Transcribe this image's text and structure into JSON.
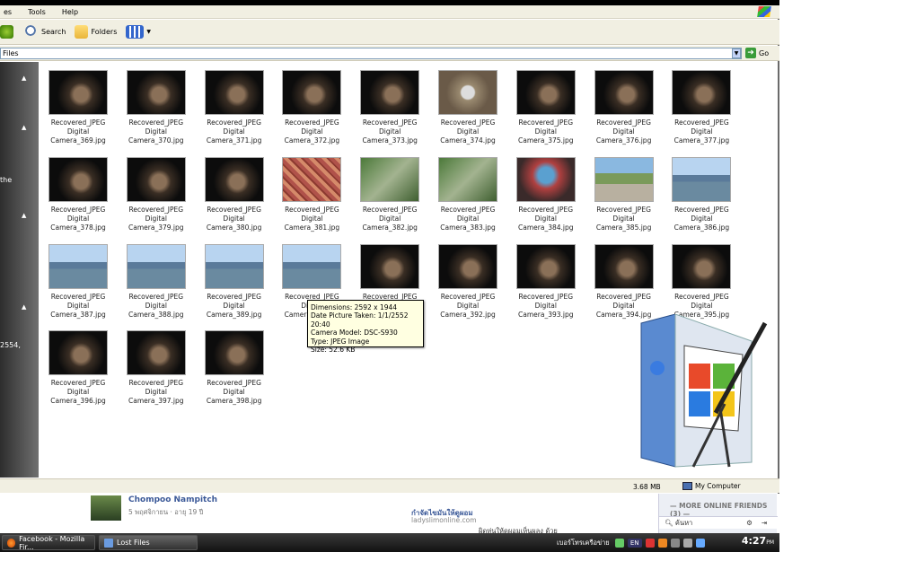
{
  "menu": {
    "items": [
      "es",
      "Tools",
      "Help"
    ]
  },
  "toolbar": {
    "search": "Search",
    "folders": "Folders"
  },
  "address": {
    "value": "Files",
    "go": "Go"
  },
  "left": {
    "text1": "the",
    "text2": "2554,"
  },
  "files": [
    "Recovered_JPEG Digital Camera_369.jpg",
    "Recovered_JPEG Digital Camera_370.jpg",
    "Recovered_JPEG Digital Camera_371.jpg",
    "Recovered_JPEG Digital Camera_372.jpg",
    "Recovered_JPEG Digital Camera_373.jpg",
    "Recovered_JPEG Digital Camera_374.jpg",
    "Recovered_JPEG Digital Camera_375.jpg",
    "Recovered_JPEG Digital Camera_376.jpg",
    "Recovered_JPEG Digital Camera_377.jpg",
    "Recovered_JPEG Digital Camera_378.jpg",
    "Recovered_JPEG Digital Camera_379.jpg",
    "Recovered_JPEG Digital Camera_380.jpg",
    "Recovered_JPEG Digital Camera_381.jpg",
    "Recovered_JPEG Digital Camera_382.jpg",
    "Recovered_JPEG Digital Camera_383.jpg",
    "Recovered_JPEG Digital Camera_384.jpg",
    "Recovered_JPEG Digital Camera_385.jpg",
    "Recovered_JPEG Digital Camera_386.jpg",
    "Recovered_JPEG Digital Camera_387.jpg",
    "Recovered_JPEG Digital Camera_388.jpg",
    "Recovered_JPEG Digital Camera_389.jpg",
    "Recovered_JPEG Digital Camera_390.jpg",
    "Recovered_JPEG Digital Camera_391.jpg",
    "Recovered_JPEG Digital Camera_392.jpg",
    "Recovered_JPEG Digital Camera_393.jpg",
    "Recovered_JPEG Digital Camera_394.jpg",
    "Recovered_JPEG Digital Camera_395.jpg",
    "Recovered_JPEG Digital Camera_396.jpg",
    "Recovered_JPEG Digital Camera_397.jpg",
    "Recovered_JPEG Digital Camera_398.jpg"
  ],
  "tooltip": {
    "dimensions": "Dimensions: 2592 x 1944",
    "date": "Date Picture Taken: 1/1/2552 20:40",
    "camera": "Camera Model: DSC-S930",
    "type": "Type: JPEG Image",
    "size": "Size: 52.6 KB"
  },
  "status": {
    "size": "3.68 MB",
    "location": "My Computer"
  },
  "facebook": {
    "name": "Chompoo Nampitch",
    "date": "5 พฤศจิกายน · อายุ 19 ปี",
    "ad_title": "กำจัดไขมันให้ดูผอม",
    "ad_url": "ladyslimonline.com",
    "ad_text": "ผิดหุ่นให้ดูผอมเห็นผลง ด้วย",
    "online_header": "— MORE ONLINE FRIENDS (3) —",
    "search_placeholder": "ค้นหา"
  },
  "taskbar": {
    "task1": "Facebook - Mozilla Fir...",
    "task2": "Lost Files",
    "tray_text": "เบอร์โทรเครือข่าย",
    "lang": "EN",
    "clock_time": "4:27",
    "clock_ampm": "PM"
  },
  "colors": {
    "taskbar": "#1b1b1b",
    "tooltip_bg": "#ffffe1",
    "fb_blue": "#3b5998"
  }
}
